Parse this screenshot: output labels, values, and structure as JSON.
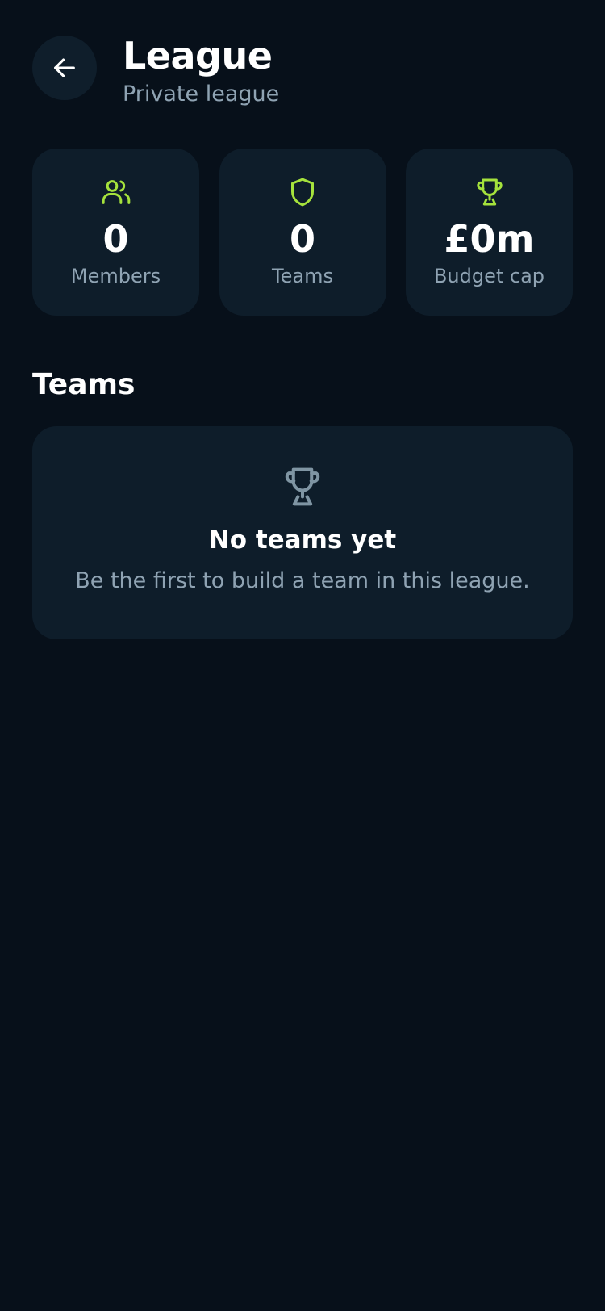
{
  "header": {
    "title": "League",
    "subtitle": "Private league",
    "back_icon": "arrow-left-icon"
  },
  "stats": [
    {
      "icon": "users-icon",
      "value": "0",
      "label": "Members"
    },
    {
      "icon": "shield-icon",
      "value": "0",
      "label": "Teams"
    },
    {
      "icon": "trophy-icon",
      "value": "£0m",
      "label": "Budget cap"
    }
  ],
  "teams_section": {
    "title": "Teams",
    "empty_state": {
      "icon": "trophy-icon",
      "title": "No teams yet",
      "text": "Be the first to build a team in this league."
    }
  },
  "colors": {
    "background": "#07101a",
    "card": "#0e1d2a",
    "accent": "#a5e23c",
    "muted_text": "#8fa3b3",
    "muted_icon": "#7f95a3"
  }
}
